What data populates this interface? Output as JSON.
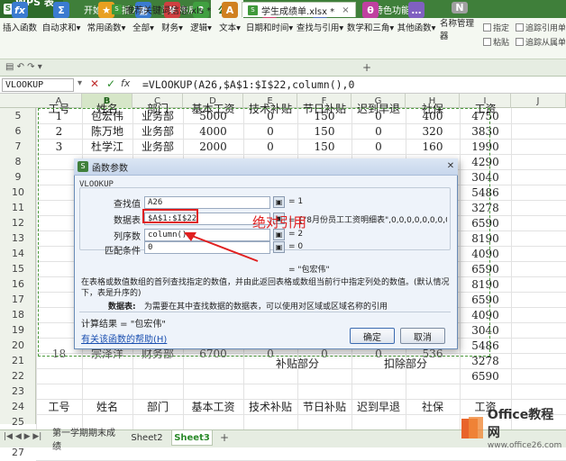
{
  "app": {
    "name": "WPS 表格"
  },
  "menu_tabs": [
    "开始",
    "插入",
    "页面布局",
    "公式",
    "数据",
    "审阅",
    "视图",
    "特色功能"
  ],
  "active_menu_tab": "公式",
  "ribbon": {
    "buttons": [
      {
        "label": "插入函数",
        "icon": "fx-icon",
        "color": "#3b7bd0"
      },
      {
        "label": "自动求和▾",
        "icon": "sigma-icon",
        "color": "#3b7bd0"
      },
      {
        "label": "常用函数▾",
        "icon": "star-icon",
        "color": "#e8a020"
      },
      {
        "label": "全部▾",
        "icon": "grid-icon",
        "color": "#3b7bd0"
      },
      {
        "label": "财务▾",
        "icon": "money-icon",
        "color": "#d04040"
      },
      {
        "label": "逻辑▾",
        "icon": "logic-icon",
        "color": "#40a040"
      },
      {
        "label": "文本▾",
        "icon": "text-icon",
        "color": "#d08020"
      },
      {
        "label": "日期和时间▾",
        "icon": "clock-icon",
        "color": "#d04070"
      },
      {
        "label": "查找与引用▾",
        "icon": "lookup-icon",
        "color": "#5070c0"
      },
      {
        "label": "数学和三角▾",
        "icon": "math-icon",
        "color": "#c040a0"
      },
      {
        "label": "其他函数▾",
        "icon": "more-icon",
        "color": "#8060c0"
      },
      {
        "label": "名称管理器",
        "icon": "name-manager-icon",
        "color": "#a0a0a0"
      },
      {
        "label": "粘贴",
        "icon": "paste-icon",
        "color": "#a0a0a0"
      }
    ],
    "small_items": [
      "指定",
      "追踪引用单元格",
      "追踪从属单元格"
    ]
  },
  "doc_tabs": [
    {
      "label": "推荐关键词信息.xls *",
      "active": false
    },
    {
      "label": "学生成绩单.xlsx *",
      "active": true
    }
  ],
  "formula_bar": {
    "name_box": "VLOOKUP",
    "formula": "=VLOOKUP(A26,$A$1:$I$22,column(),0"
  },
  "columns": [
    "A",
    "B",
    "C",
    "D",
    "E",
    "F",
    "G",
    "H",
    "I",
    "J"
  ],
  "top_header_row": {
    "row": "4",
    "cells": [
      "工号",
      "姓名",
      "部门",
      "基本工资",
      "技术补贴",
      "节日补贴",
      "迟到早退",
      "社保",
      "工资"
    ]
  },
  "rows": [
    {
      "row": "5",
      "cells": [
        "1",
        "包宏伟",
        "业务部",
        "5000",
        "0",
        "150",
        "0",
        "400",
        "4750"
      ]
    },
    {
      "row": "6",
      "cells": [
        "2",
        "陈万地",
        "业务部",
        "4000",
        "0",
        "150",
        "0",
        "320",
        "3830"
      ]
    },
    {
      "row": "7",
      "cells": [
        "3",
        "杜学江",
        "业务部",
        "2000",
        "0",
        "150",
        "0",
        "160",
        "1990"
      ]
    },
    {
      "row": "8",
      "cells": [
        "",
        "",
        "",
        "",
        "",
        "",
        "",
        "",
        "4290"
      ]
    },
    {
      "row": "9",
      "cells": [
        "",
        "",
        "",
        "",
        "",
        "",
        "",
        "",
        "3040"
      ]
    },
    {
      "row": "10",
      "cells": [
        "",
        "",
        "",
        "",
        "",
        "",
        "",
        "",
        "5486"
      ]
    },
    {
      "row": "11",
      "cells": [
        "",
        "",
        "",
        "",
        "",
        "",
        "",
        "",
        "3278"
      ]
    },
    {
      "row": "12",
      "cells": [
        "",
        "",
        "",
        "",
        "",
        "",
        "",
        "",
        "6590"
      ]
    },
    {
      "row": "13",
      "cells": [
        "",
        "",
        "",
        "",
        "",
        "",
        "",
        "",
        "8190"
      ]
    },
    {
      "row": "14",
      "cells": [
        "",
        "",
        "",
        "",
        "",
        "",
        "",
        "",
        "4090"
      ]
    },
    {
      "row": "15",
      "cells": [
        "",
        "",
        "",
        "",
        "",
        "",
        "",
        "",
        "6590"
      ]
    },
    {
      "row": "16",
      "cells": [
        "",
        "",
        "",
        "",
        "",
        "",
        "",
        "",
        "8190"
      ]
    },
    {
      "row": "17",
      "cells": [
        "",
        "",
        "",
        "",
        "",
        "",
        "",
        "",
        "6590"
      ]
    },
    {
      "row": "18",
      "cells": [
        "",
        "",
        "",
        "",
        "",
        "",
        "",
        "",
        "4090"
      ]
    },
    {
      "row": "19",
      "cells": [
        "",
        "",
        "",
        "",
        "",
        "",
        "",
        "",
        "3040"
      ]
    },
    {
      "row": "20",
      "cells": [
        "",
        "",
        "",
        "",
        "",
        "",
        "",
        "",
        "5486"
      ]
    },
    {
      "row": "21",
      "cells": [
        "",
        "",
        "",
        "",
        "",
        "",
        "",
        "",
        "3278"
      ]
    },
    {
      "row": "22",
      "cells": [
        "",
        "",
        "",
        "",
        "",
        "",
        "",
        "",
        "6590"
      ]
    },
    {
      "row": "23",
      "cells": [
        "",
        "",
        "",
        "",
        "",
        "",
        "",
        "",
        ""
      ]
    },
    {
      "row": "24",
      "cells": [
        "工号",
        "姓名",
        "部门",
        "基本工资",
        "技术补贴",
        "节日补贴",
        "迟到早退",
        "社保",
        "工资"
      ]
    },
    {
      "row": "25",
      "cells": [
        "",
        "",
        "",
        "",
        "",
        "",
        "",
        "",
        ""
      ]
    },
    {
      "row": "26",
      "cells": [
        "1",
        "=VLOOKUP(A26,$A$1:$I$22,column(),0",
        "",
        "",
        "",
        "",
        "",
        "",
        ""
      ]
    },
    {
      "row": "27",
      "cells": [
        "",
        "",
        "",
        "",
        "",
        "",
        "",
        "",
        ""
      ]
    }
  ],
  "partial_row_18": [
    "18",
    "宗泽洋",
    "财务部",
    "6700",
    "0",
    "0",
    "0",
    "536"
  ],
  "group_headers": {
    "subsidy": "补贴部分",
    "deduction": "扣除部分"
  },
  "dialog": {
    "title": "函数参数",
    "function_name": "VLOOKUP",
    "fields": [
      {
        "label": "查找值",
        "value": "A26",
        "result": "= 1"
      },
      {
        "label": "数据表",
        "value": "$A$1:$I$22",
        "result": "= {\"8月份员工工资明细表\",0,0,0,0,0,0,0,0;\"工号\",\"..."
      },
      {
        "label": "列序数",
        "value": "column()",
        "result": "= 2"
      },
      {
        "label": "匹配条件",
        "value": "0",
        "result": "= 0"
      }
    ],
    "center_result": "= \"包宏伟\"",
    "description": "在表格或数值数组的首列查找指定的数值，并由此返回表格或数组当前行中指定列处的数值。(默认情况下，表是升序的)",
    "param_label": "数据表:",
    "param_description": "为需要在其中查找数据的数据表，可以使用对区域或区域名称的引用",
    "calc_result_label": "计算结果 = \"包宏伟\"",
    "help_link": "有关该函数的帮助(H)",
    "ok_label": "确定",
    "cancel_label": "取消"
  },
  "annotation": {
    "text": "绝对引用",
    "color": "#e02020"
  },
  "sheet_tabs": [
    {
      "label": "第一学期期末成绩",
      "active": false
    },
    {
      "label": "Sheet2",
      "active": false
    },
    {
      "label": "Sheet3",
      "active": true
    }
  ],
  "watermark": {
    "brand": "Office教程网",
    "url": "www.office26.com"
  }
}
